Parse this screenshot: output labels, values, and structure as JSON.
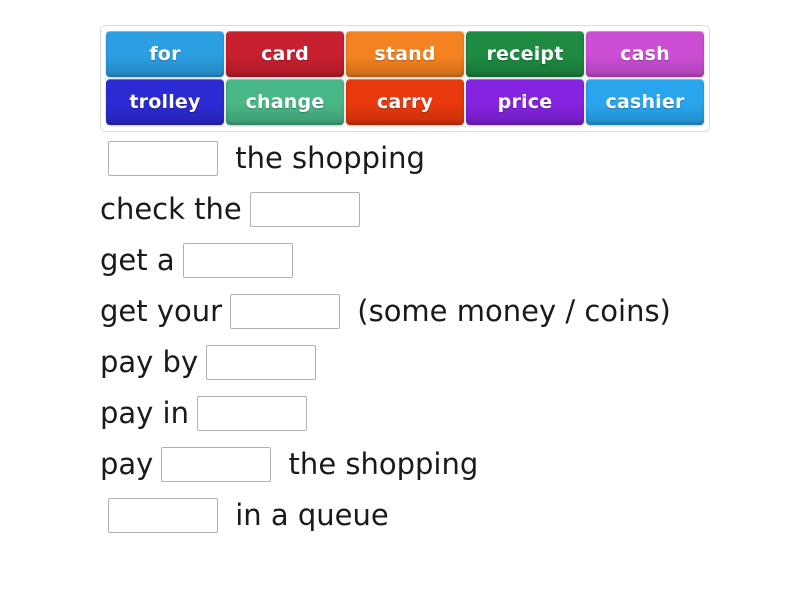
{
  "word_bank": {
    "name": "word-bank",
    "rows": [
      [
        {
          "label": "for",
          "color": "#2b9fe2"
        },
        {
          "label": "card",
          "color": "#c8202f"
        },
        {
          "label": "stand",
          "color": "#f58220"
        },
        {
          "label": "receipt",
          "color": "#1e8a42"
        },
        {
          "label": "cash",
          "color": "#cc4ed4"
        }
      ],
      [
        {
          "label": "trolley",
          "color": "#2b2bd4"
        },
        {
          "label": "change",
          "color": "#49b787"
        },
        {
          "label": "carry",
          "color": "#e8380d"
        },
        {
          "label": "price",
          "color": "#8423e0"
        },
        {
          "label": "cashier",
          "color": "#29a5ee"
        }
      ]
    ]
  },
  "sentences": [
    {
      "before": "",
      "after": " the shopping"
    },
    {
      "before": "check the",
      "after": ""
    },
    {
      "before": "get a",
      "after": ""
    },
    {
      "before": "get your",
      "after": " (some money / coins)"
    },
    {
      "before": "pay by",
      "after": ""
    },
    {
      "before": "pay in",
      "after": ""
    },
    {
      "before": "pay",
      "after": " the shopping"
    },
    {
      "before": "",
      "after": " in a queue"
    }
  ]
}
